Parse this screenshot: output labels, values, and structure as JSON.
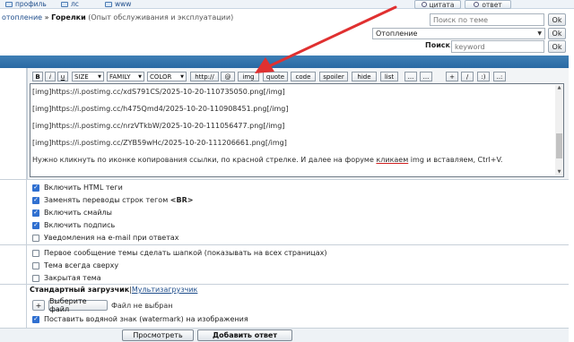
{
  "top": {
    "links": [
      "профиль",
      "лс",
      "www"
    ],
    "quote_button": "цитата",
    "reply_button": "ответ"
  },
  "breadcrumb": {
    "parent": "отопление",
    "separator": "»",
    "current": "Горелки",
    "description": "(Опыт обслуживания и эксплуатации)"
  },
  "topic_search": {
    "placeholder": "Поиск по теме",
    "ok": "Ok"
  },
  "forum_select": {
    "value": "Отопление",
    "ok": "Ok"
  },
  "search": {
    "label": "Поиск:",
    "placeholder": "keyword",
    "ok": "Ok"
  },
  "toolbar": {
    "bold": "B",
    "italic": "i",
    "underline": "u",
    "size": "SIZE",
    "family": "FAMILY",
    "color": "COLOR",
    "url": "http://",
    "email": "@",
    "img": "img",
    "quote": "quote",
    "code": "code",
    "spoiler": "spoiler",
    "hide": "hide",
    "list": "list",
    "b1": "...",
    "b2": "...",
    "b3": "+",
    "b4": "/",
    "b5": ":)",
    "b6": "..:"
  },
  "editor": {
    "lines": [
      "[img]https://i.postimg.cc/xdS791CS/2025-10-20-110735050.png[/img]",
      "[img]https://i.postimg.cc/h475Qmd4/2025-10-20-110908451.png[/img]",
      "[img]https://i.postimg.cc/nrzVTkbW/2025-10-20-111056477.png[/img]",
      "[img]https://i.postimg.cc/ZYB59wHc/2025-10-20-111206661.png[/img]"
    ],
    "note_before": "Нужно кликнуть по иконке копирования ссылки, по красной стрелке. И далее на форуме ",
    "note_underlined": "кликаем",
    "note_after": " img и вставляем, Ctrl+V."
  },
  "options": {
    "html_tags": "Включить HTML теги",
    "line_breaks_prefix": "Заменять переводы строк тегом ",
    "line_breaks_tag": "<BR>",
    "smilies": "Включить смайлы",
    "signature": "Включить подпись",
    "email_notify": "Уведомления на e-mail при ответах",
    "first_post_header": "Первое сообщение темы сделать шапкой (показывать на всех страницах)",
    "always_top": "Тема всегда сверху",
    "closed_topic": "Закрытая тема",
    "checked": {
      "html_tags": true,
      "line_breaks": true,
      "smilies": true,
      "signature": true,
      "email_notify": false,
      "first_post_header": false,
      "always_top": false,
      "closed_topic": false,
      "watermark": true
    }
  },
  "uploader": {
    "standard": "Стандартный загрузчик",
    "divider": "|",
    "multi": "Мультизагрузчик",
    "add": "+",
    "choose_file": "Выберите файл",
    "no_file": "Файл не выбран",
    "watermark": "Поставить водяной знак (watermark) на изображения"
  },
  "actions": {
    "preview": "Просмотреть",
    "submit": "Добавить ответ"
  },
  "colors": {
    "bar_blue": "#2f71aa",
    "arrow_red": "#e03030",
    "checkbox_blue": "#2f6fd0"
  }
}
